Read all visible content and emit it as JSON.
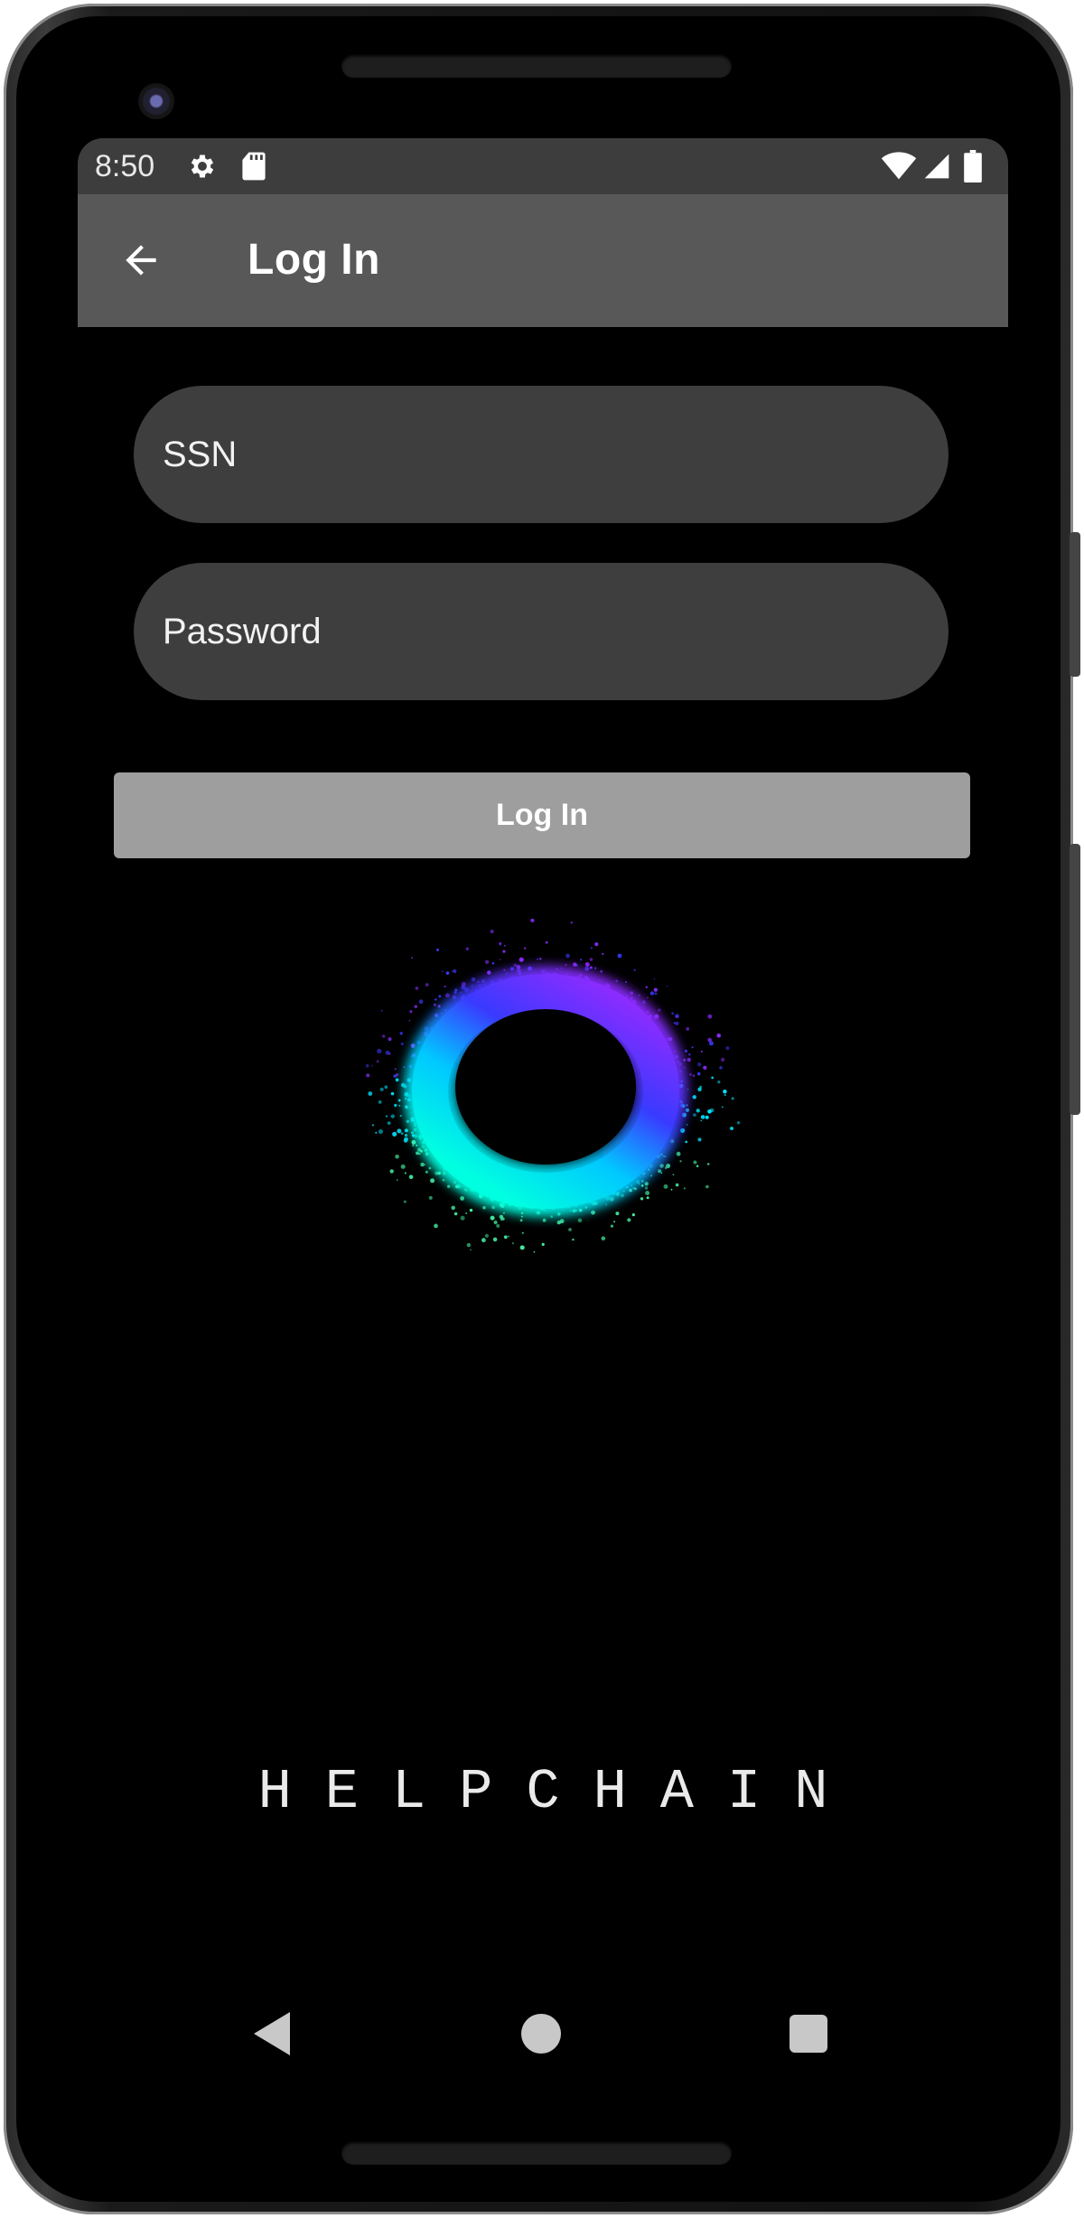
{
  "status_bar": {
    "time": "8:50",
    "icons": [
      "settings-gear-icon",
      "sd-card-icon",
      "wifi-icon",
      "cell-signal-icon",
      "battery-icon"
    ]
  },
  "app_bar": {
    "title": "Log In",
    "back_icon": "arrow-left-icon"
  },
  "form": {
    "ssn_placeholder": "SSN",
    "password_placeholder": "Password",
    "login_label": "Log In"
  },
  "brand": {
    "name": "HELPCHAIN",
    "logo_icon": "particle-ring-logo"
  },
  "nav": {
    "icons": [
      "back-triangle-icon",
      "home-circle-icon",
      "recents-square-icon"
    ]
  },
  "colors": {
    "status_bar": "#3d3d3d",
    "app_bar": "#585858",
    "field_bg": "#3e3e3e",
    "button_bg": "#9e9e9e",
    "background": "#000000",
    "ring_cyan": "#00e5ff",
    "ring_blue": "#3a3aff",
    "ring_violet": "#8a2cff",
    "ring_green": "#46f0a0"
  }
}
